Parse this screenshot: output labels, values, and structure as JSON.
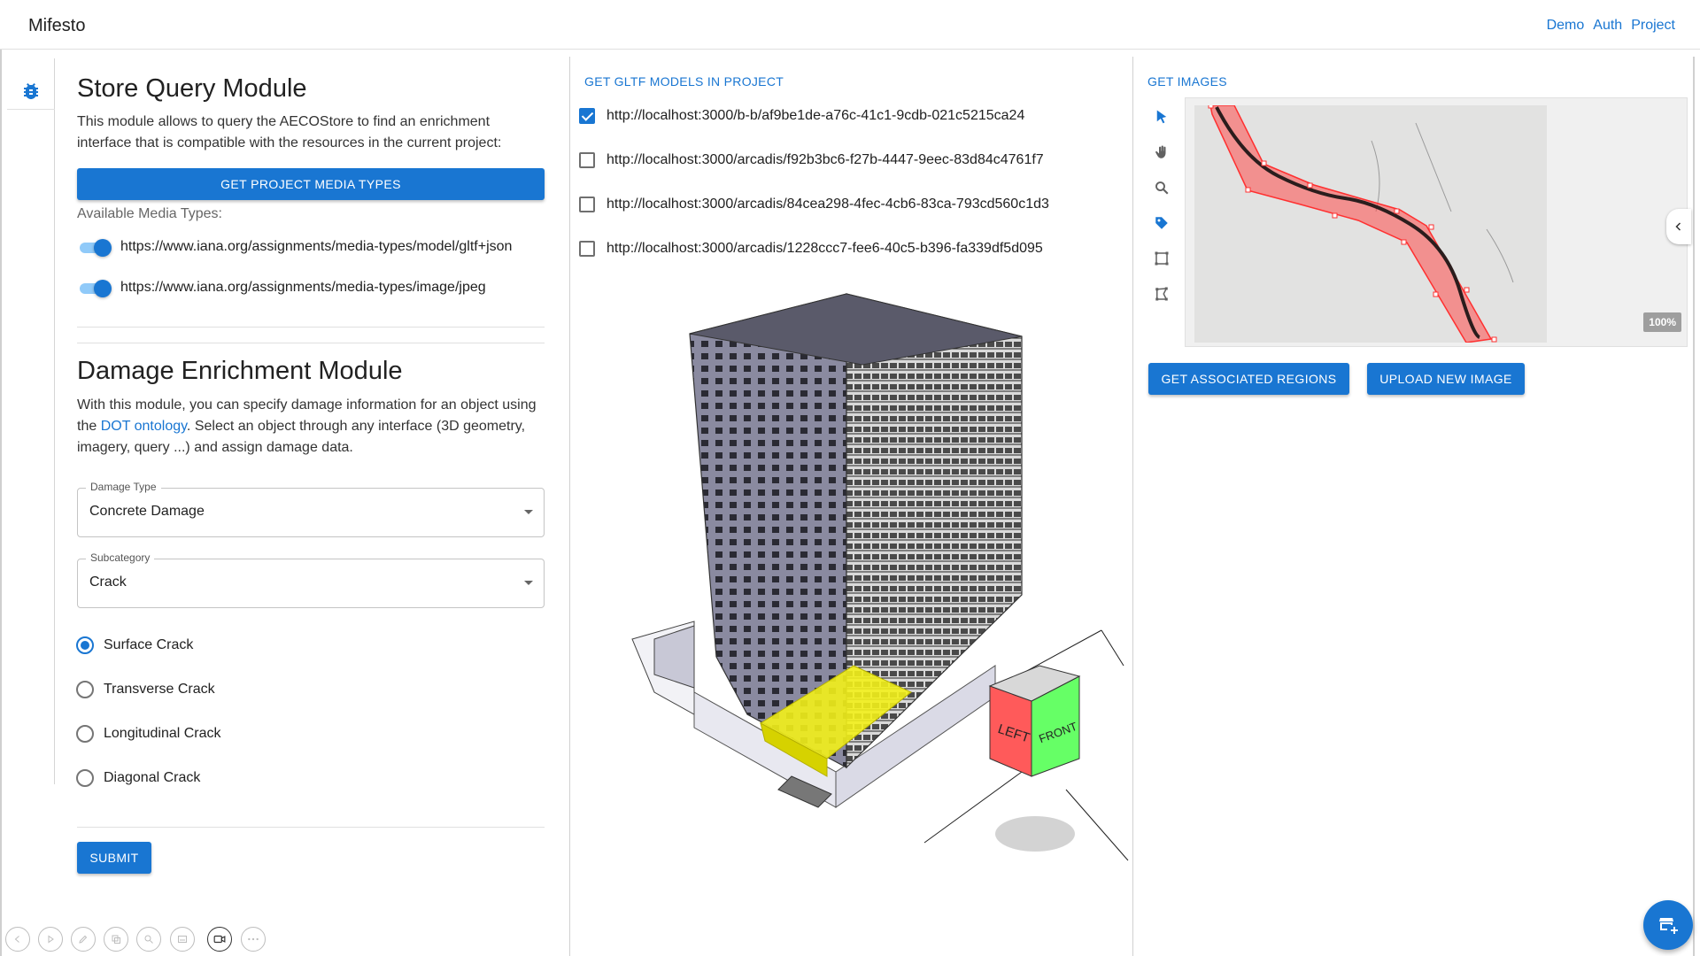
{
  "app": {
    "title": "Mifesto"
  },
  "nav": {
    "links": [
      "Demo",
      "Auth",
      "Project"
    ]
  },
  "store_query": {
    "title": "Store Query Module",
    "description": "This module allows to query the AECOStore to find an enrichment interface that is compatible with the resources in the current project:",
    "button_label": "GET PROJECT MEDIA TYPES",
    "media_types_label": "Available Media Types:",
    "media_types": [
      {
        "url": "https://www.iana.org/assignments/media-types/model/gltf+json",
        "enabled": true
      },
      {
        "url": "https://www.iana.org/assignments/media-types/image/jpeg",
        "enabled": true
      }
    ]
  },
  "damage": {
    "title": "Damage Enrichment Module",
    "desc_part1": "With this module, you can specify damage information for an object using the ",
    "desc_link": "DOT ontology",
    "desc_part2": ". Select an object through any interface (3D geometry, imagery, query ...) and assign damage data.",
    "damage_type": {
      "label": "Damage Type",
      "value": "Concrete Damage"
    },
    "subcategory": {
      "label": "Subcategory",
      "value": "Crack"
    },
    "options": [
      {
        "label": "Surface Crack",
        "selected": true
      },
      {
        "label": "Transverse Crack",
        "selected": false
      },
      {
        "label": "Longitudinal Crack",
        "selected": false
      },
      {
        "label": "Diagonal Crack",
        "selected": false
      }
    ],
    "submit_label": "SUBMIT"
  },
  "gltf": {
    "header": "GET GLTF MODELS IN PROJECT",
    "models": [
      {
        "url": "http://localhost:3000/b-b/af9be1de-a76c-41c1-9cdb-021c5215ca24",
        "checked": true
      },
      {
        "url": "http://localhost:3000/arcadis/f92b3bc6-f27b-4447-9eec-83d84c4761f7",
        "checked": false
      },
      {
        "url": "http://localhost:3000/arcadis/84cea298-4fec-4cb6-83ca-793cd560c1d3",
        "checked": false
      },
      {
        "url": "http://localhost:3000/arcadis/1228ccc7-fee6-40c5-b396-fa339df5d095",
        "checked": false
      }
    ],
    "viewcube": {
      "left": "LEFT",
      "front": "FRONT"
    }
  },
  "images": {
    "header": "GET IMAGES",
    "zoom": "100%",
    "tools": [
      "pointer-icon",
      "hand-icon",
      "search-icon",
      "tag-icon",
      "bounding-box-icon",
      "polygon-icon"
    ],
    "associated_regions_label": "GET ASSOCIATED REGIONS",
    "upload_label": "UPLOAD NEW IMAGE"
  },
  "colors": {
    "primary": "#1976d2",
    "highlight": "#f2ef1a",
    "crack_region": "#ff4d4d"
  }
}
